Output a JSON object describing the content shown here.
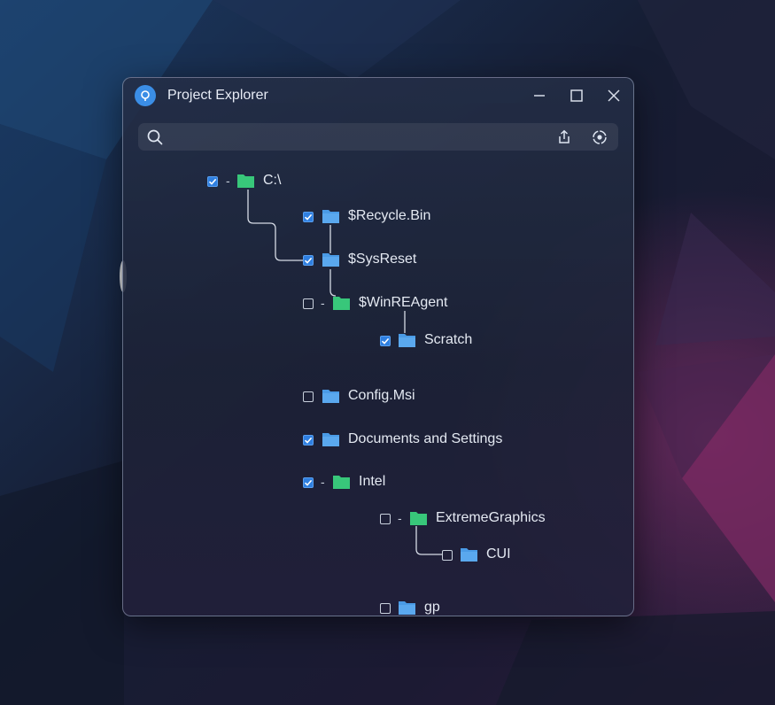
{
  "window": {
    "title": "Project Explorer"
  },
  "search": {
    "placeholder": ""
  },
  "tree": {
    "c_drive": "C:\\",
    "recycle_bin": "$Recycle.Bin",
    "sysreset": "$SysReset",
    "winreagent": "$WinREAgent",
    "scratch": "Scratch",
    "config_msi": "Config.Msi",
    "documents": "Documents and Settings",
    "intel": "Intel",
    "extremegraphics": "ExtremeGraphics",
    "cui": "CUI",
    "gp": "gp"
  },
  "colors": {
    "folder_blue": "#4a9be6",
    "folder_green": "#38c77a",
    "checkbox_on": "#2f7fe0",
    "accent": "#3b8ee6"
  }
}
